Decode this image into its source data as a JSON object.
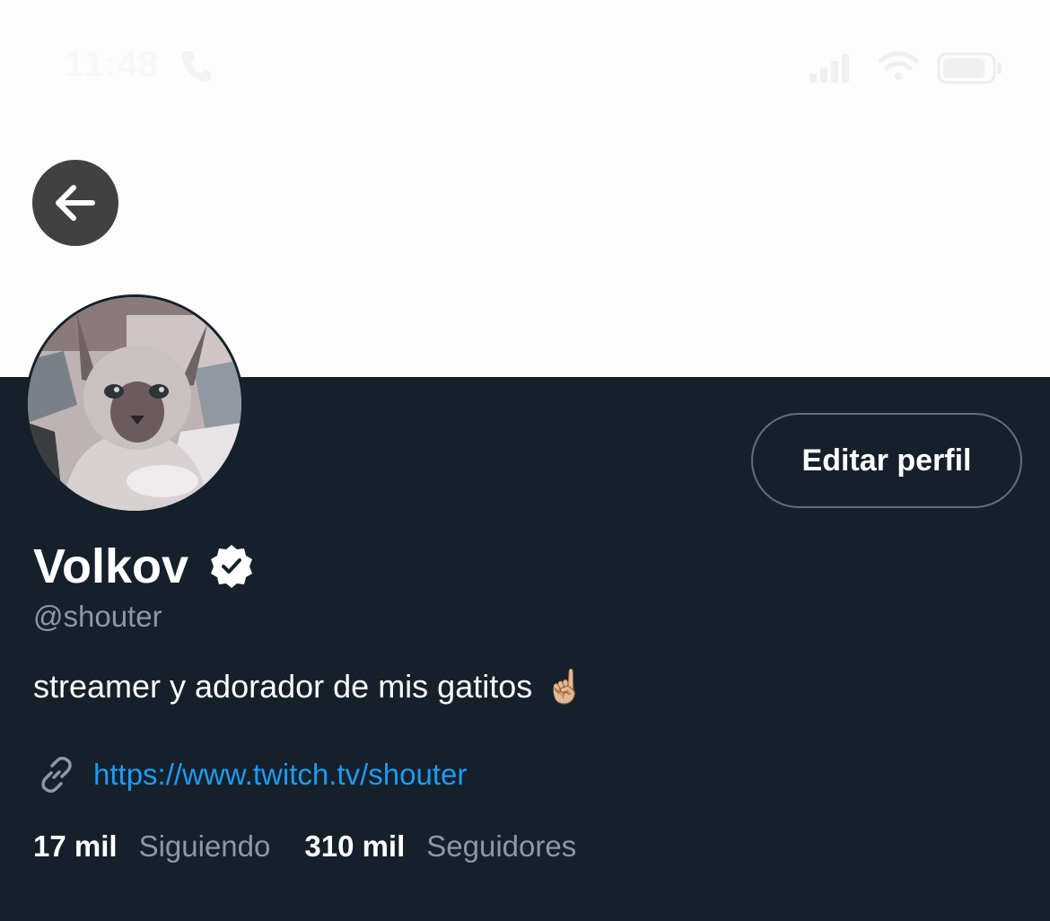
{
  "status_bar": {
    "time": "11:48",
    "icons": [
      "phone-icon",
      "signal-icon",
      "wifi-icon",
      "battery-icon"
    ]
  },
  "header": {
    "back_icon": "arrow-left-icon"
  },
  "profile": {
    "display_name": "Volkov",
    "verified": true,
    "handle": "@shouter",
    "bio": "streamer y adorador de mis gatitos",
    "bio_emoji": "☝🏼",
    "link": "https://www.twitch.tv/shouter",
    "edit_button_label": "Editar perfil",
    "stats": {
      "following_count": "17 mil",
      "following_label": "Siguiendo",
      "followers_count": "310 mil",
      "followers_label": "Seguidores"
    }
  },
  "colors": {
    "background": "#15202b",
    "banner": "#fdfdfd",
    "link": "#1d9bf0",
    "muted_text": "#8b98a5",
    "button_border": "#5b6f83"
  }
}
